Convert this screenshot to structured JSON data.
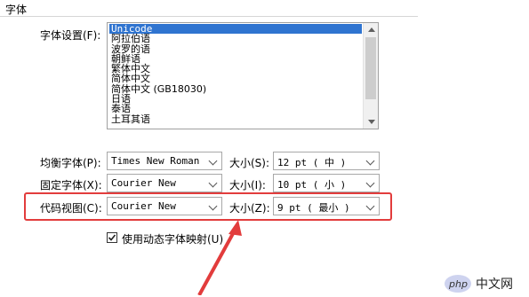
{
  "section": {
    "title": "字体"
  },
  "font_settings": {
    "label": "字体设置(F):",
    "items": [
      "Unicode",
      "阿拉伯语",
      "波罗的语",
      "朝鲜语",
      "繁体中文",
      "简体中文",
      "简体中文 (GB18030)",
      "日语",
      "泰语",
      "土耳其语"
    ],
    "selected": "Unicode"
  },
  "proportional": {
    "label": "均衡字体(P):",
    "font": "Times New Roman",
    "size_label": "大小(S):",
    "size": "12 pt  ( 中 )"
  },
  "fixed": {
    "label": "固定字体(X):",
    "font": "Courier New",
    "size_label": "大小(I):",
    "size": "10 pt  ( 小 )"
  },
  "code_view": {
    "label": "代码视图(C):",
    "font": "Courier New",
    "size_label": "大小(Z):",
    "size": "9 pt   ( 最小 )"
  },
  "dynamic_mapping": {
    "label": "使用动态字体映射(U)",
    "checked": true
  },
  "annotation": {
    "color": "#e23c3c"
  },
  "watermark": {
    "brand": "php",
    "site": "中文网"
  }
}
